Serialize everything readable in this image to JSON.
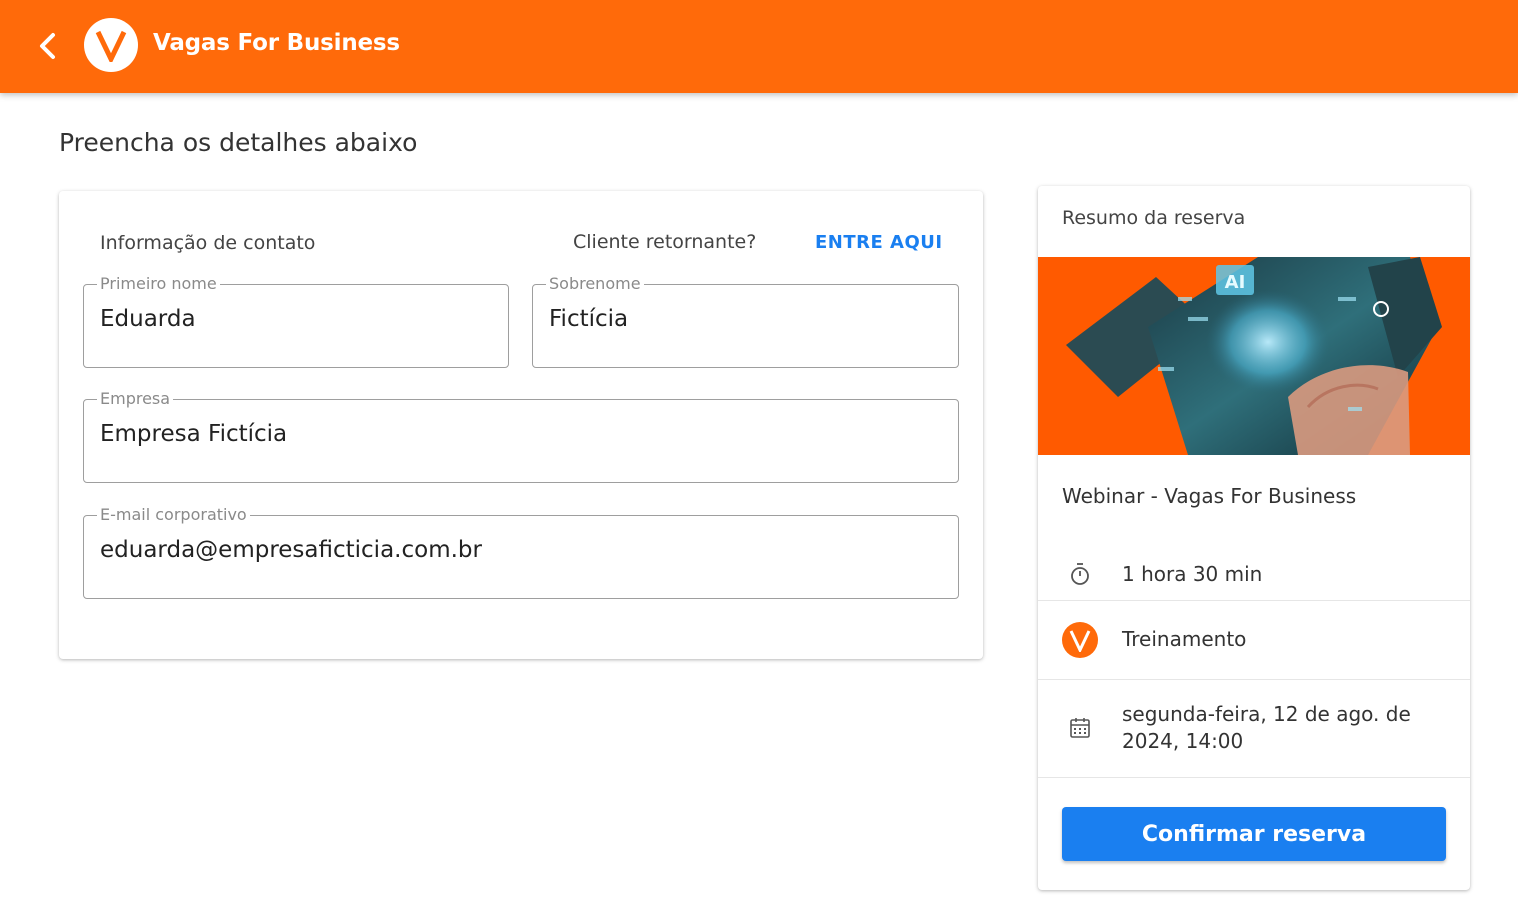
{
  "header": {
    "app_title": "Vagas For Business",
    "brand_color": "#ff6a0a"
  },
  "page": {
    "title": "Preencha os detalhes abaixo"
  },
  "form": {
    "section_label": "Informação de contato",
    "returning_label": "Cliente retornante?",
    "login_link": "ENTRE AQUI",
    "fields": {
      "first_name": {
        "label": "Primeiro nome",
        "value": "Eduarda"
      },
      "last_name": {
        "label": "Sobrenome",
        "value": "Fictícia"
      },
      "company": {
        "label": "Empresa",
        "value": "Empresa Fictícia"
      },
      "email": {
        "label": "E-mail corporativo",
        "value": "eduarda@empresaficticia.com.br"
      }
    }
  },
  "summary": {
    "title": "Resumo da reserva",
    "event_title": "Webinar - Vagas For Business",
    "duration": "1 hora 30 min",
    "category": "Treinamento",
    "datetime": "segunda-feira, 12 de ago. de 2024, 14:00",
    "confirm_label": "Confirmar reserva",
    "banner_text": "AI"
  },
  "icons": {
    "back": "chevron-left-icon",
    "logo": "v-logo-icon",
    "duration": "stopwatch-icon",
    "category": "v-logo-icon",
    "date": "calendar-icon"
  },
  "colors": {
    "accent": "#1a7ff0",
    "orange": "#ff6a0a"
  }
}
